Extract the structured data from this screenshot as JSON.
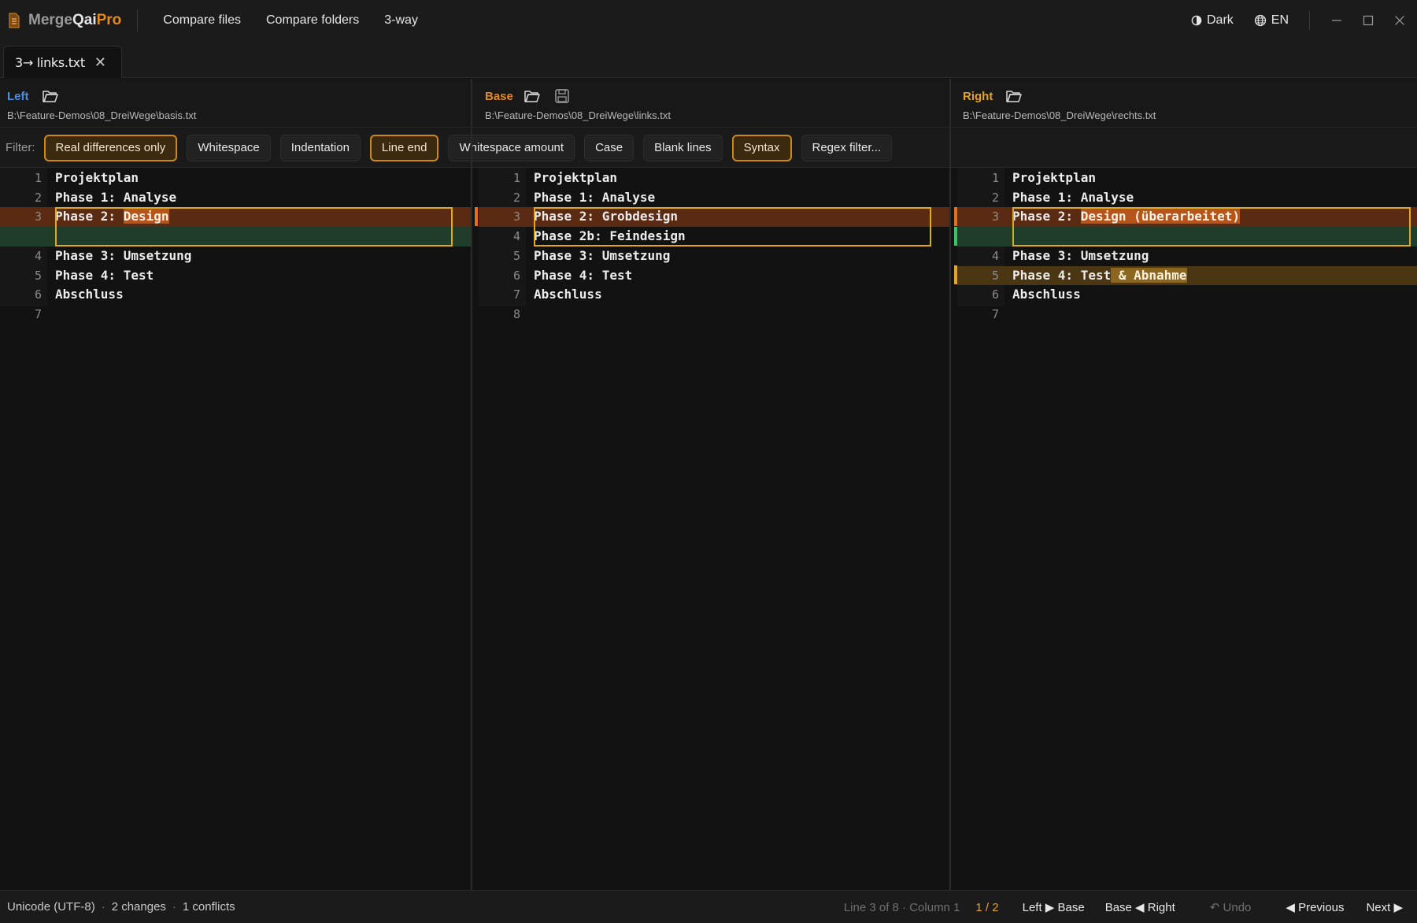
{
  "app": {
    "brand_a": "Merge",
    "brand_b": "Qai",
    "brand_c": "Pro"
  },
  "menu": [
    "Compare files",
    "Compare folders",
    "3-way"
  ],
  "title_right": {
    "theme": "Dark",
    "lang": "EN"
  },
  "tab": {
    "label": "3→ links.txt",
    "close": "✕"
  },
  "panes": {
    "left": {
      "name": "Left",
      "path": "B:\\Feature-Demos\\08_DreiWege\\basis.txt",
      "color": "#4a90e2"
    },
    "base": {
      "name": "Base",
      "path": "B:\\Feature-Demos\\08_DreiWege\\links.txt",
      "color": "#e58a1f"
    },
    "right": {
      "name": "Right",
      "path": "B:\\Feature-Demos\\08_DreiWege\\rechts.txt",
      "color": "#e2a52a"
    }
  },
  "filter": {
    "label": "Filter:",
    "buttons": [
      {
        "label": "Real differences only",
        "active": true
      },
      {
        "label": "Whitespace",
        "active": false
      },
      {
        "label": "Indentation",
        "active": false
      },
      {
        "label": "Line end",
        "active": true
      },
      {
        "label": "Whitespace amount",
        "active": false
      },
      {
        "label": "Case",
        "active": false
      },
      {
        "label": "Blank lines",
        "active": false
      },
      {
        "label": "Syntax",
        "active": true
      },
      {
        "label": "Regex filter...",
        "active": false
      }
    ]
  },
  "left_lines": [
    {
      "n": "1",
      "pre": "Projektplan"
    },
    {
      "n": "2",
      "pre": "Phase 1: Analyse"
    },
    {
      "n": "3",
      "pre": "Phase 2: ",
      "tok": "Design",
      "hl": "o",
      "tok_hl": "o"
    },
    {
      "n": "",
      "pre": "",
      "hl": "g"
    },
    {
      "n": "4",
      "pre": "Phase 3: Umsetzung"
    },
    {
      "n": "5",
      "pre": "Phase 4: Test"
    },
    {
      "n": "6",
      "pre": "Abschluss"
    },
    {
      "n": "7",
      "pre": ""
    }
  ],
  "base_lines": [
    {
      "n": "1",
      "pre": "Projektplan"
    },
    {
      "n": "2",
      "pre": "Phase 1: Analyse"
    },
    {
      "n": "3",
      "pre": "Phase 2: Grobdesign",
      "hl": "o"
    },
    {
      "n": "4",
      "pre": "Phase 2b: Feindesign"
    },
    {
      "n": "5",
      "pre": "Phase 3: Umsetzung"
    },
    {
      "n": "6",
      "pre": "Phase 4: Test"
    },
    {
      "n": "7",
      "pre": "Abschluss"
    },
    {
      "n": "8",
      "pre": ""
    }
  ],
  "right_lines": [
    {
      "n": "1",
      "pre": "Projektplan"
    },
    {
      "n": "2",
      "pre": "Phase 1: Analyse"
    },
    {
      "n": "3",
      "pre": "Phase 2: ",
      "tok": "Design (überarbeitet)",
      "hl": "o",
      "tok_hl": "o"
    },
    {
      "n": "",
      "pre": "",
      "hl": "g"
    },
    {
      "n": "4",
      "pre": "Phase 3: Umsetzung"
    },
    {
      "n": "5",
      "pre": "Phase 4: Test",
      "tok": " & Abnahme",
      "hl": "y",
      "tok_hl": "y"
    },
    {
      "n": "6",
      "pre": "Abschluss"
    },
    {
      "n": "7",
      "pre": ""
    }
  ],
  "status": {
    "encoding": "Unicode (UTF-8)",
    "changes": "2 changes",
    "conflicts": "1 conflicts",
    "dot": "·",
    "position": "Line 3 of 8 · Column 1",
    "count": "1 / 2",
    "left_to_base": "Left ▶ Base",
    "base_to_right": "Base ◀ Right",
    "undo": "↶ Undo",
    "previous": "◀ Previous",
    "next": "Next ▶"
  },
  "colors": {
    "accent": "#e58a1f",
    "conflict_box": "#e0a91f",
    "change_orange": "#5a2a12",
    "change_green": "#1f3d2a"
  }
}
